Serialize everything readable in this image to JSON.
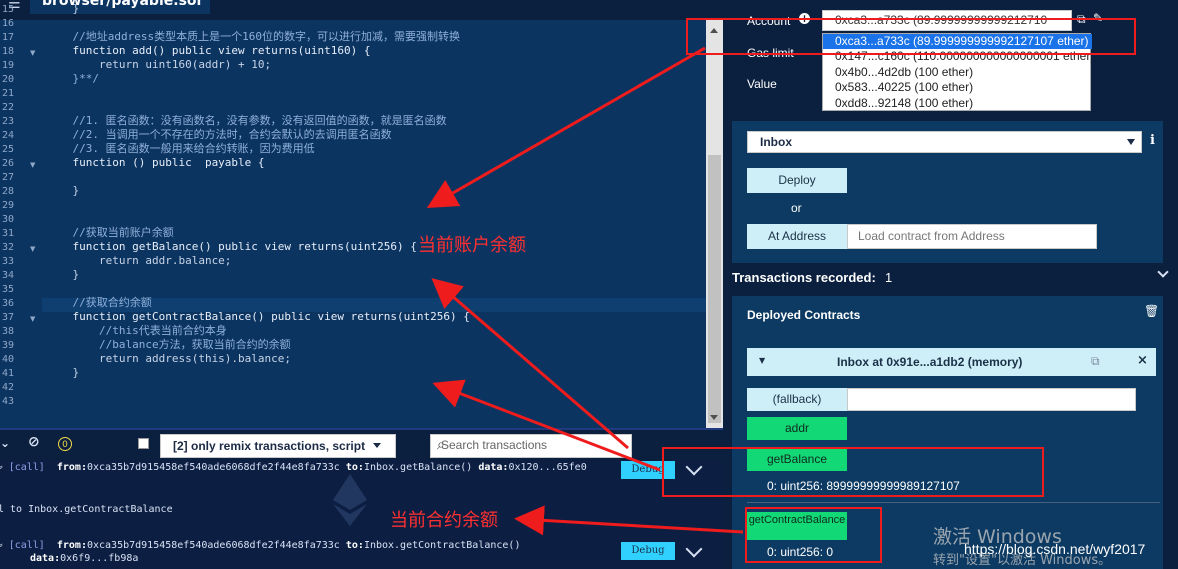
{
  "editor": {
    "tab_title": "browser/payable.sol",
    "lines": [
      {
        "n": "15",
        "text": "    }"
      },
      {
        "n": "16",
        "text": ""
      },
      {
        "n": "17",
        "text": "    //地址address类型本质上是一个160位的数字，可以进行加减，需要强制转换"
      },
      {
        "n": "18",
        "text": "    function add() public view returns(uint160) {"
      },
      {
        "n": "19",
        "text": "        return uint160(addr) + 10;"
      },
      {
        "n": "20",
        "text": "    }**/"
      },
      {
        "n": "21",
        "text": ""
      },
      {
        "n": "22",
        "text": ""
      },
      {
        "n": "23",
        "text": "    //1. 匿名函数：没有函数名，没有参数，没有返回值的函数，就是匿名函数"
      },
      {
        "n": "24",
        "text": "    //2. 当调用一个不存在的方法时，合约会默认的去调用匿名函数"
      },
      {
        "n": "25",
        "text": "    //3. 匿名函数一般用来给合约转账，因为费用低"
      },
      {
        "n": "26",
        "text": "    function () public  payable {"
      },
      {
        "n": "27",
        "text": ""
      },
      {
        "n": "28",
        "text": "    }"
      },
      {
        "n": "29",
        "text": ""
      },
      {
        "n": "30",
        "text": ""
      },
      {
        "n": "31",
        "text": "    //获取当前账户余额"
      },
      {
        "n": "32",
        "text": "    function getBalance() public view returns(uint256) {"
      },
      {
        "n": "33",
        "text": "        return addr.balance;"
      },
      {
        "n": "34",
        "text": "    }"
      },
      {
        "n": "35",
        "text": ""
      },
      {
        "n": "36",
        "text": "    //获取合约余额"
      },
      {
        "n": "37",
        "text": "    function getContractBalance() public view returns(uint256) {"
      },
      {
        "n": "38",
        "text": "        //this代表当前合约本身"
      },
      {
        "n": "39",
        "text": "        //balance方法，获取当前合约的余额"
      },
      {
        "n": "40",
        "text": "        return address(this).balance;"
      },
      {
        "n": "41",
        "text": "    }"
      },
      {
        "n": "42",
        "text": ""
      },
      {
        "n": "43",
        "text": ""
      }
    ]
  },
  "terminal": {
    "filter_label": "[2] only remix transactions, script",
    "search_placeholder": "Search transactions",
    "log1_prefix": "[call]",
    "log1_from_label": "from:",
    "log1_from": "0xca35b7d915458ef540ade6068dfe2f44e8fa733c",
    "log1_to_label": "to:",
    "log1_to": "Inbox.getBalance()",
    "log1_data_label": "data:",
    "log1_data": "0x120...65fe0",
    "log1_debug": "Debug",
    "log_mid": "l to Inbox.getContractBalance",
    "log2_prefix": "[call]",
    "log2_from_label": "from:",
    "log2_from": "0xca35b7d915458ef540ade6068dfe2f44e8fa733c",
    "log2_to_label": "to:",
    "log2_to": "Inbox.getContractBalance()",
    "log2_data_label": "data:",
    "log2_data": "0x6f9...fb98a",
    "log2_debug": "Debug"
  },
  "run": {
    "account_label": "Account",
    "account_value": "0xca3...a733c (89.99999999999212710",
    "gas_limit_label": "Gas limit",
    "value_label": "Value",
    "account_options": [
      "0xca3...a733c (89.999999999992127107 ether)",
      "0x147...c160c (110.000000000000000001 ether)",
      "0x4b0...4d2db (100 ether)",
      "0x583...40225 (100 ether)",
      "0xdd8...92148 (100 ether)"
    ],
    "contract_select": "Inbox",
    "deploy_label": "Deploy",
    "or_label": "or",
    "at_address_label": "At Address",
    "load_placeholder": "Load contract from Address",
    "transactions_label": "Transactions recorded:",
    "transactions_count": "1",
    "deployed_title": "Deployed Contracts",
    "instance_label": "Inbox at 0x91e...a1db2 (memory)",
    "fallback_label": "(fallback)",
    "addr_label": "addr",
    "getbalance_label": "getBalance",
    "getbalance_result": "0: uint256: 89999999999989127107",
    "getcontractbalance_label": "getContractBalance",
    "getcontractbalance_result": "0: uint256: 0"
  },
  "annotations": {
    "current_account_balance": "当前账户余额",
    "current_contract_balance": "当前合约余额"
  },
  "watermark": {
    "line1": "激活 Windows",
    "line2": "转到\"设置\"以激活 Windows。",
    "url": "https://blog.csdn.net/wyf2017"
  },
  "colors": {
    "editor_bg": "#0c3461",
    "panel_bg": "#0b1f3f",
    "card_bg": "#0c3a62",
    "green_button": "#13d876",
    "cyan_button": "#cfeff8",
    "annotation_red": "#ee1c1c"
  }
}
